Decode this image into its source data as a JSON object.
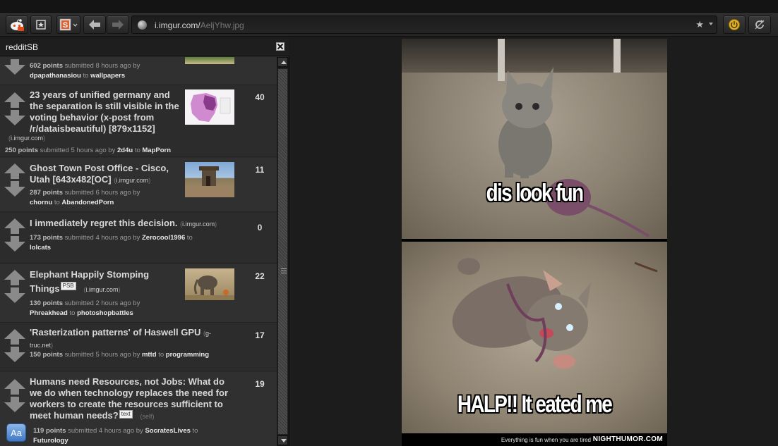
{
  "toolbar": {
    "url_host": "i.imgur.com/",
    "url_path": "AeljYhw.jpg"
  },
  "sidebar": {
    "title": "redditSB",
    "posts": [
      {
        "title": "",
        "domain": "",
        "points": "602 points",
        "submitted": "submitted 8 hours ago",
        "by": "by",
        "author": "dpapathanasiou",
        "to": "to",
        "subreddit": "wallpapers",
        "comments": ""
      },
      {
        "title": "23 years of unified germany and the separation is still visible in the voting behavior (x-post from /r/dataisbeautiful) [879x1152]",
        "domain": "i.imgur.com",
        "points": "250 points",
        "submitted": "submitted 5 hours ago",
        "by": "by",
        "author": "2d4u",
        "to": "to",
        "subreddit": "MapPorn",
        "comments": "40"
      },
      {
        "title": "Ghost Town Post Office - Cisco, Utah [643x482[OC]",
        "domain": "i.imgur.com",
        "points": "287 points",
        "submitted": "submitted 6 hours ago",
        "by": "by",
        "author": "chornu",
        "to": "to",
        "subreddit": "AbandonedPorn",
        "comments": "11"
      },
      {
        "title": "I immediately regret this decision.",
        "domain": "i.imgur.com",
        "points": "173 points",
        "submitted": "submitted 4 hours ago",
        "by": "by",
        "author": "Zerocool1996",
        "to": "to",
        "subreddit": "lolcats",
        "comments": "0"
      },
      {
        "title": "Elephant Happily Stomping Things",
        "tag": "PSB",
        "domain": "i.imgur.com",
        "points": "130 points",
        "submitted": "submitted 2 hours ago",
        "by": "by",
        "author": "Phreakhead",
        "to": "to",
        "subreddit": "photoshopbattles",
        "comments": "22"
      },
      {
        "title": "'Rasterization patterns' of Haswell GPU",
        "domain": "g-truc.net",
        "points": "150 points",
        "submitted": "submitted 5 hours ago",
        "by": "by",
        "author": "mttd",
        "to": "to",
        "subreddit": "programming",
        "comments": "17"
      },
      {
        "title": "Humans need Resources, not Jobs: What do we do when technology replaces the need for workers to create the resources sufficient to meet human needs?",
        "tag": "text",
        "domain": "self",
        "points": "119 points",
        "submitted": "submitted 4 hours ago",
        "by": "by",
        "author": "SocratesLives",
        "to": "to",
        "subreddit": "Futurology",
        "comments": "19"
      }
    ],
    "font_icon_label": "Aa"
  },
  "meme": {
    "top_caption": "dis look fun",
    "bottom_caption": "HALP!! It eated me",
    "footer_small": "Everything is fun when you are tired",
    "footer_brand": "NIGHTHUMOR.COM"
  }
}
